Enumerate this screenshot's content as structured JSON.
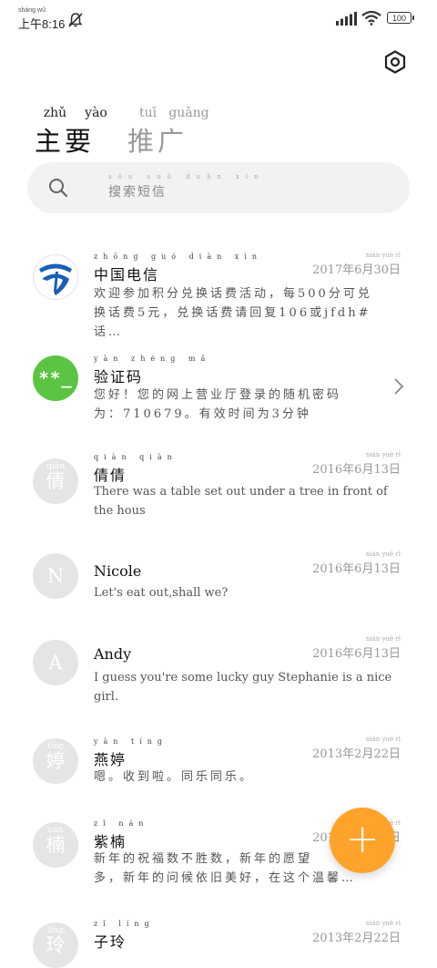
{
  "status_bar": {
    "time": "上午8:16",
    "time_pinyin": "shàng wǔ",
    "battery": "100"
  },
  "tabs": [
    {
      "label": "主要",
      "pinyin": [
        "zhǔ",
        "yào"
      ],
      "active": true
    },
    {
      "label": "推广",
      "pinyin": [
        "tuī",
        "guǎng"
      ],
      "active": false
    }
  ],
  "search": {
    "placeholder": "搜索短信",
    "placeholder_pinyin": "sōu suǒ duǎn xìn"
  },
  "messages": [
    {
      "name": "中国电信",
      "name_pinyin": "zhōng guó diàn xìn",
      "date": "2017年6月30日",
      "date_pinyin": "nián yuè rì",
      "preview_line1": "欢迎参加积分兑换话费活动，每500分可兑",
      "preview_line2": "换话费5元，兑换话费请回复106或jfdh#话…",
      "avatar": "telecom-logo"
    },
    {
      "name": "验证码",
      "name_pinyin": "yàn zhèng mǎ",
      "date": "",
      "preview_line1": "您好！您的网上营业厅登录的随机密码",
      "preview_line2": "为：710679。有效时间为3分钟",
      "avatar": "**_",
      "avatar_color": "#5cc443"
    },
    {
      "name": "倩倩",
      "name_pinyin": "qiàn qiàn",
      "date": "2016年6月13日",
      "date_pinyin": "nián yuè rì",
      "preview_line1": "There was a table set out under a tree in front of",
      "preview_line2": "the hous",
      "avatar": "倩",
      "avatar_pinyin": "qiàn"
    },
    {
      "name": "Nicole",
      "date": "2016年6月13日",
      "date_pinyin": "nián yuè rì",
      "preview_line1": "Let's eat out,shall we?",
      "preview_line2": "",
      "avatar": "N"
    },
    {
      "name": "Andy",
      "date": "2016年6月13日",
      "date_pinyin": "nián yuè rì",
      "preview_line1": "I guess you're some lucky guy Stephanie is a nice",
      "preview_line2": "girl.",
      "avatar": "A"
    },
    {
      "name": "燕婷",
      "name_pinyin": "yàn tíng",
      "date": "2013年2月22日",
      "date_pinyin": "nián yuè rì",
      "preview_line1": "嗯。收到啦。同乐同乐。",
      "preview_line2": "",
      "avatar": "婷",
      "avatar_pinyin": "tíng"
    },
    {
      "name": "紫楠",
      "name_pinyin": "zǐ nán",
      "date": "2013年2月22日",
      "date_pinyin": "nián yuè rì",
      "preview_line1": "新年的祝福数不胜数，新年的愿望",
      "preview_line2": "多，新年的问候依旧美好，在这个温馨…",
      "avatar": "楠",
      "avatar_pinyin": "nán"
    },
    {
      "name": "子玲",
      "name_pinyin": "zǐ líng",
      "date": "2013年2月22日",
      "date_pinyin": "nián yuè rì",
      "preview_line1": "",
      "preview_line2": "",
      "avatar": "玲",
      "avatar_pinyin": "líng"
    }
  ],
  "fab": {
    "label": "+"
  },
  "colors": {
    "accent": "#ffa32b",
    "verify_avatar": "#5cc443",
    "telecom_blue": "#1a5fb4"
  }
}
